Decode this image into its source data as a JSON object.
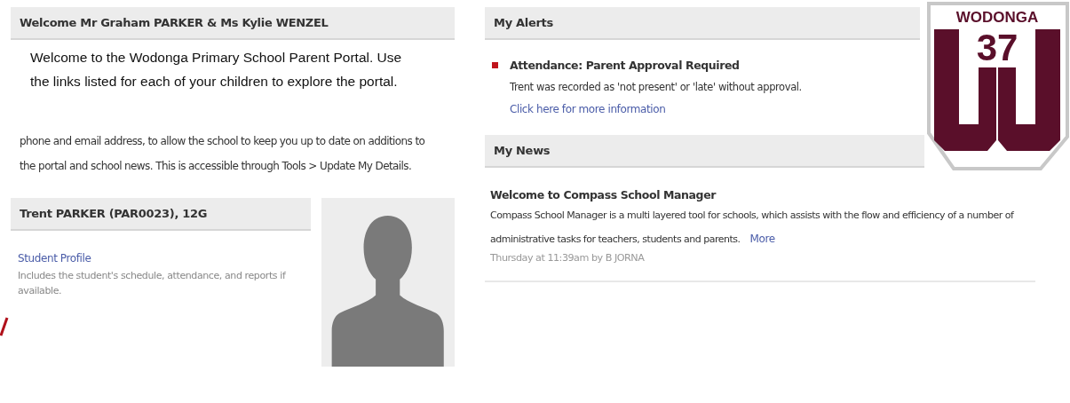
{
  "welcome": {
    "title": "Welcome Mr Graham PARKER & Ms Kylie WENZEL",
    "intro": "Welcome to the Wodonga Primary School Parent Portal. Use the links listed for each of your children to explore the portal.",
    "body": "phone and email address, to allow the school to keep you up to date on additions to the portal and school news. This is accessible through Tools > Update My Details."
  },
  "student": {
    "title": "Trent PARKER (PAR0023), 12G",
    "link": "Student Profile",
    "description": "Includes the student's schedule, attendance, and reports if available."
  },
  "alerts": {
    "title": "My Alerts",
    "items": [
      {
        "title": "Attendance: Parent Approval Required",
        "text": "Trent was recorded as 'not present' or 'late' without approval.",
        "link": "Click here for more information",
        "color": "#c0141c"
      }
    ]
  },
  "news": {
    "title": "My News",
    "items": [
      {
        "title": "Welcome to Compass School Manager",
        "text": "Compass School Manager is a multi layered tool for schools, which assists with the flow and efficiency of a number of administrative tasks for teachers, students and parents.",
        "more": "More",
        "meta": "Thursday at 11:39am by B JORNA"
      }
    ]
  },
  "logo": {
    "name": "WODONGA",
    "number": "37"
  }
}
